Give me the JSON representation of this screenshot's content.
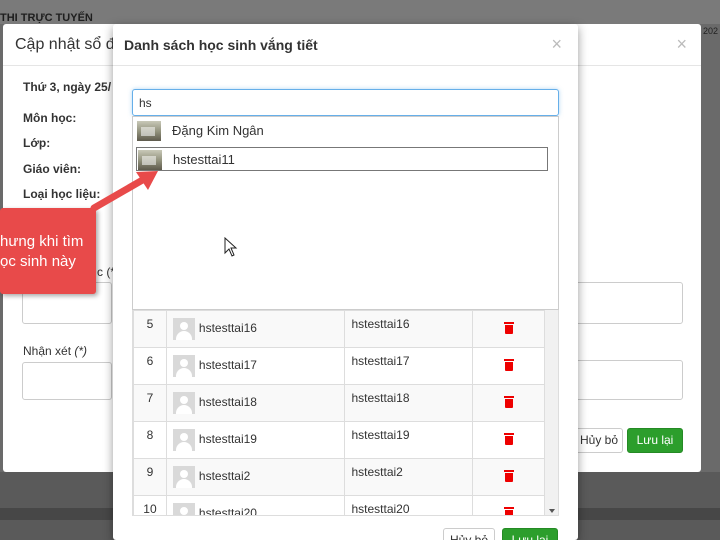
{
  "background": {
    "page_title": "THI TRỰC TUYẾN",
    "year_fragment": "202"
  },
  "modal_update": {
    "title": "Cập nhật sổ đầ",
    "close_symbol": "×",
    "date": "Thứ 3, ngày 25/",
    "labels": {
      "subject": "Môn học:",
      "class": "Lớp:",
      "teacher": "Giáo viên:",
      "material_type": "Loại học liệu:",
      "content_fragment": "c (*)",
      "comment": "Nhận xét",
      "required": "(*)"
    },
    "buttons": {
      "cancel": "Hủy bỏ",
      "save": "Lưu lại"
    }
  },
  "modal_absent": {
    "title": "Danh sách học sinh vắng tiết",
    "close_symbol": "×",
    "search": {
      "value": "hs"
    },
    "suggestions": [
      {
        "name": "Đặng Kim Ngân"
      },
      {
        "name": "hstesttai11"
      }
    ],
    "table_rows": [
      {
        "stt": "5",
        "name": "hstesttai16",
        "username": "hstesttai16"
      },
      {
        "stt": "6",
        "name": "hstesttai17",
        "username": "hstesttai17"
      },
      {
        "stt": "7",
        "name": "hstesttai18",
        "username": "hstesttai18"
      },
      {
        "stt": "8",
        "name": "hstesttai19",
        "username": "hstesttai19"
      },
      {
        "stt": "9",
        "name": "hstesttai2",
        "username": "hstesttai2"
      },
      {
        "stt": "10",
        "name": "hstesttai20",
        "username": "hstesttai20"
      }
    ],
    "buttons": {
      "cancel": "Hủy bỏ",
      "save": "Lưu lại"
    }
  },
  "annotation": {
    "line1": "hưng khi tìm",
    "line2": "ọc sinh này"
  },
  "colors": {
    "save_green": "#2c9e2c",
    "delete_red": "#e00000",
    "callout_red": "#e84a4a",
    "focus_blue": "#66afe9"
  }
}
